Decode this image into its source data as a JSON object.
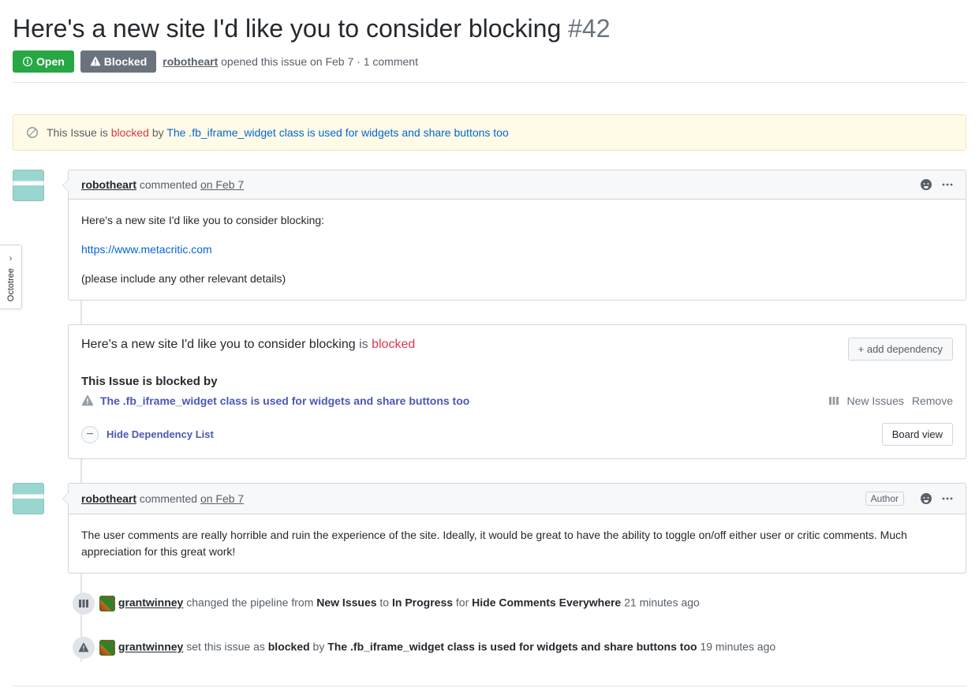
{
  "issue": {
    "title": "Here's a new site I'd like you to consider blocking",
    "number": "#42",
    "state_open": "Open",
    "state_blocked": "Blocked",
    "author": "robotheart",
    "opened_text": "opened this issue",
    "opened_date": "on Feb 7",
    "comment_count": "1 comment"
  },
  "banner": {
    "prefix": "This Issue is",
    "status": "blocked",
    "by": "by",
    "link": "The .fb_iframe_widget class is used for widgets and share buttons too"
  },
  "comments": [
    {
      "author": "robotheart",
      "action": "commented",
      "date": "on Feb 7",
      "body_line1": "Here's a new site I'd like you to consider blocking:",
      "body_link": "https://www.metacritic.com",
      "body_line3": "(please include any other relevant details)",
      "author_badge": ""
    },
    {
      "author": "robotheart",
      "action": "commented",
      "date": "on Feb 7",
      "body": "The user comments are really horrible and ruin the experience of the site. Ideally, it would be great to have the ability to toggle on/off either user or critic comments. Much appreciation for this great work!",
      "author_badge": "Author"
    }
  ],
  "dep_card": {
    "title": "Here's a new site I'd like you to consider blocking",
    "is_word": "is",
    "status": "blocked",
    "add_btn": "+ add dependency",
    "blocked_by_title": "This Issue is blocked by",
    "dep_link": "The .fb_iframe_widget class is used for widgets and share buttons too",
    "column_label": "New Issues",
    "remove_label": "Remove",
    "hide_label": "Hide Dependency List",
    "board_view": "Board view",
    "minus": "−"
  },
  "events": [
    {
      "icon": "pipeline",
      "author": "grantwinney",
      "text1": "changed the pipeline from",
      "from": "New Issues",
      "text2": "to",
      "to": "In Progress",
      "text3": "for",
      "target": "Hide Comments Everywhere",
      "when": "21 minutes ago"
    },
    {
      "icon": "blocked",
      "author": "grantwinney",
      "text1": "set this issue as",
      "status": "blocked",
      "text2": "by",
      "link": "The .fb_iframe_widget class is used for widgets and share buttons too",
      "when": "19 minutes ago"
    }
  ],
  "sidebar_tab": "Octotree"
}
